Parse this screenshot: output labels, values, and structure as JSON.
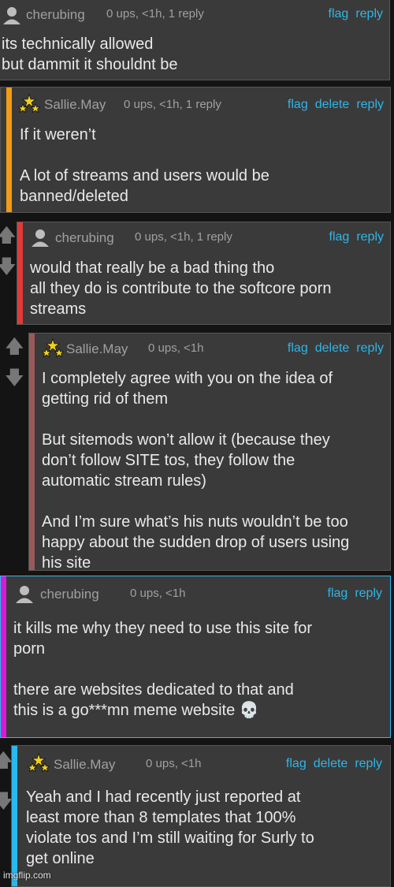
{
  "comments": [
    {
      "username": "cherubing",
      "meta": "0 ups, <1h, 1 reply",
      "actions": [
        "flag",
        "reply"
      ],
      "body": "its technically allowed\nbut dammit it shouldnt be"
    },
    {
      "username": "Sallie.May",
      "meta": "0 ups, <1h, 1 reply",
      "actions": [
        "flag",
        "delete",
        "reply"
      ],
      "body": "If it weren’t\n\nA lot of streams and users would be\nbanned/deleted"
    },
    {
      "username": "cherubing",
      "meta": "0 ups, <1h, 1 reply",
      "actions": [
        "flag",
        "reply"
      ],
      "body": "would that really be a bad thing tho\nall they do is contribute to the softcore porn\nstreams"
    },
    {
      "username": "Sallie.May",
      "meta": "0 ups, <1h",
      "actions": [
        "flag",
        "delete",
        "reply"
      ],
      "body": "I completely agree with you on the idea of\ngetting rid of them\n\nBut sitemods won’t allow it (because they\ndon’t follow SITE tos, they follow the\nautomatic stream rules)\n\nAnd I’m sure what’s his nuts wouldn’t be too\nhappy about the sudden drop of users using\nhis site"
    },
    {
      "username": "cherubing",
      "meta": "0 ups, <1h",
      "actions": [
        "flag",
        "reply"
      ],
      "body": "it kills me why they need to use this site for\nporn\n\nthere are websites dedicated to that and\nthis is a go***mn meme website",
      "emoji": "💀"
    },
    {
      "username": "Sallie.May",
      "meta": "0 ups, <1h",
      "actions": [
        "flag",
        "delete",
        "reply"
      ],
      "body": "Yeah and I had recently just reported at\nleast more than 8 templates that 100%\nviolate tos and I’m still waiting for Surly to\nget online"
    }
  ],
  "colors": {
    "accent": "#2fb6e6",
    "bar_orange": "#f39b12",
    "bar_red": "#e23a3a",
    "bar_brown": "#9a5a5a",
    "bar_magenta": "#d81ad8",
    "bar_blue": "#2ab8ef"
  },
  "icons": {
    "user": "user-silhouette-icon",
    "star": "star-badge-icon",
    "up": "arrow-up-icon",
    "down": "arrow-down-icon"
  },
  "watermark": "imgflip.com"
}
